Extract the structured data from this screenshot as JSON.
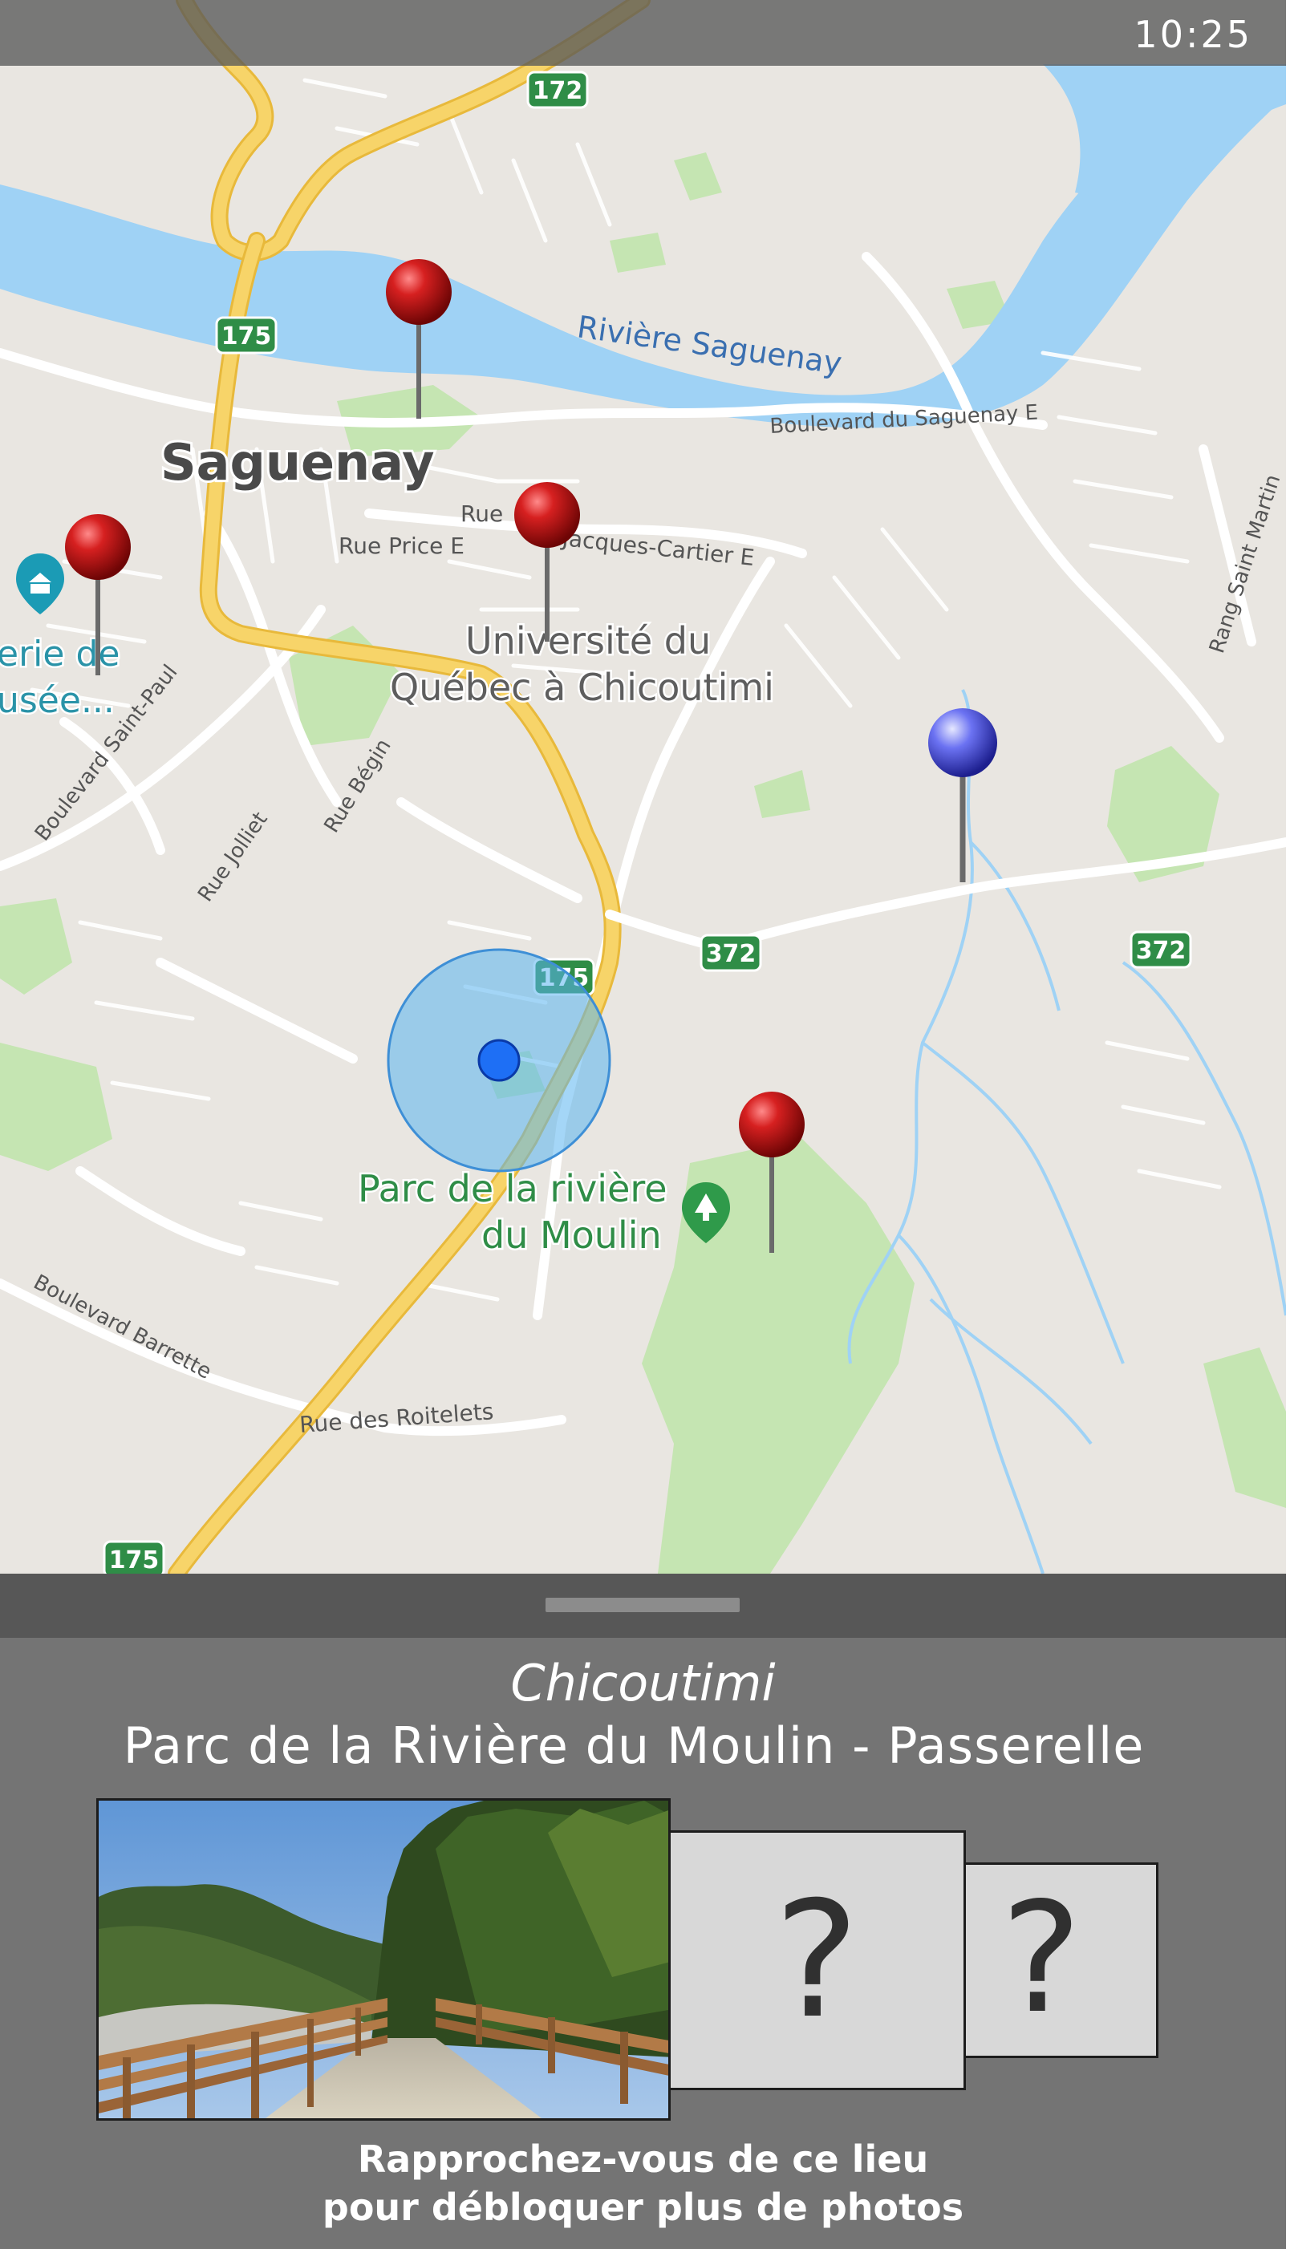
{
  "status_bar": {
    "time": "10:25"
  },
  "map": {
    "labels": {
      "city": "Saguenay",
      "river": "Rivière Saguenay",
      "boulevard_saguenay": "Boulevard du Saguenay E",
      "rue": "Rue",
      "rue_price": "Rue Price E",
      "jacques_cartier": "Jacques-Cartier E",
      "university_line1": "Université du",
      "university_line2": "Québec à Chicoutimi",
      "museum_line1": "erie de",
      "museum_line2": "usée...",
      "boulevard_saint_paul": "Boulevard Saint-Paul",
      "rue_jolliet": "Rue Jolliet",
      "rue_begin": "Rue Bégin",
      "rang_saint_martin": "Rang Saint Martin",
      "park_line1": "Parc de la rivière",
      "park_line2": "du Moulin",
      "boulevard_barrette": "Boulevard Barrette",
      "rue_roitelets": "Rue des Roitelets"
    },
    "route_shields": {
      "r172": "172",
      "r175_a": "175",
      "r175_b": "175",
      "r175_c": "175",
      "r372_a": "372",
      "r372_b": "372"
    },
    "colors": {
      "land": "#e9e6e1",
      "water": "#9fd2f5",
      "park": "#c5e5b2",
      "highway": "#f7d469",
      "shield": "#2f8d47",
      "pin_red": "#c41a1a",
      "pin_blue": "#5a62e6",
      "user_location": "#1e6ff5"
    }
  },
  "sheet": {
    "city": "Chicoutimi",
    "place": "Parc de la Rivière du Moulin - Passerelle",
    "locked_photo_marker": "?",
    "hint_line1": "Rapprochez-vous de ce lieu",
    "hint_line2": "pour débloquer plus de photos"
  }
}
